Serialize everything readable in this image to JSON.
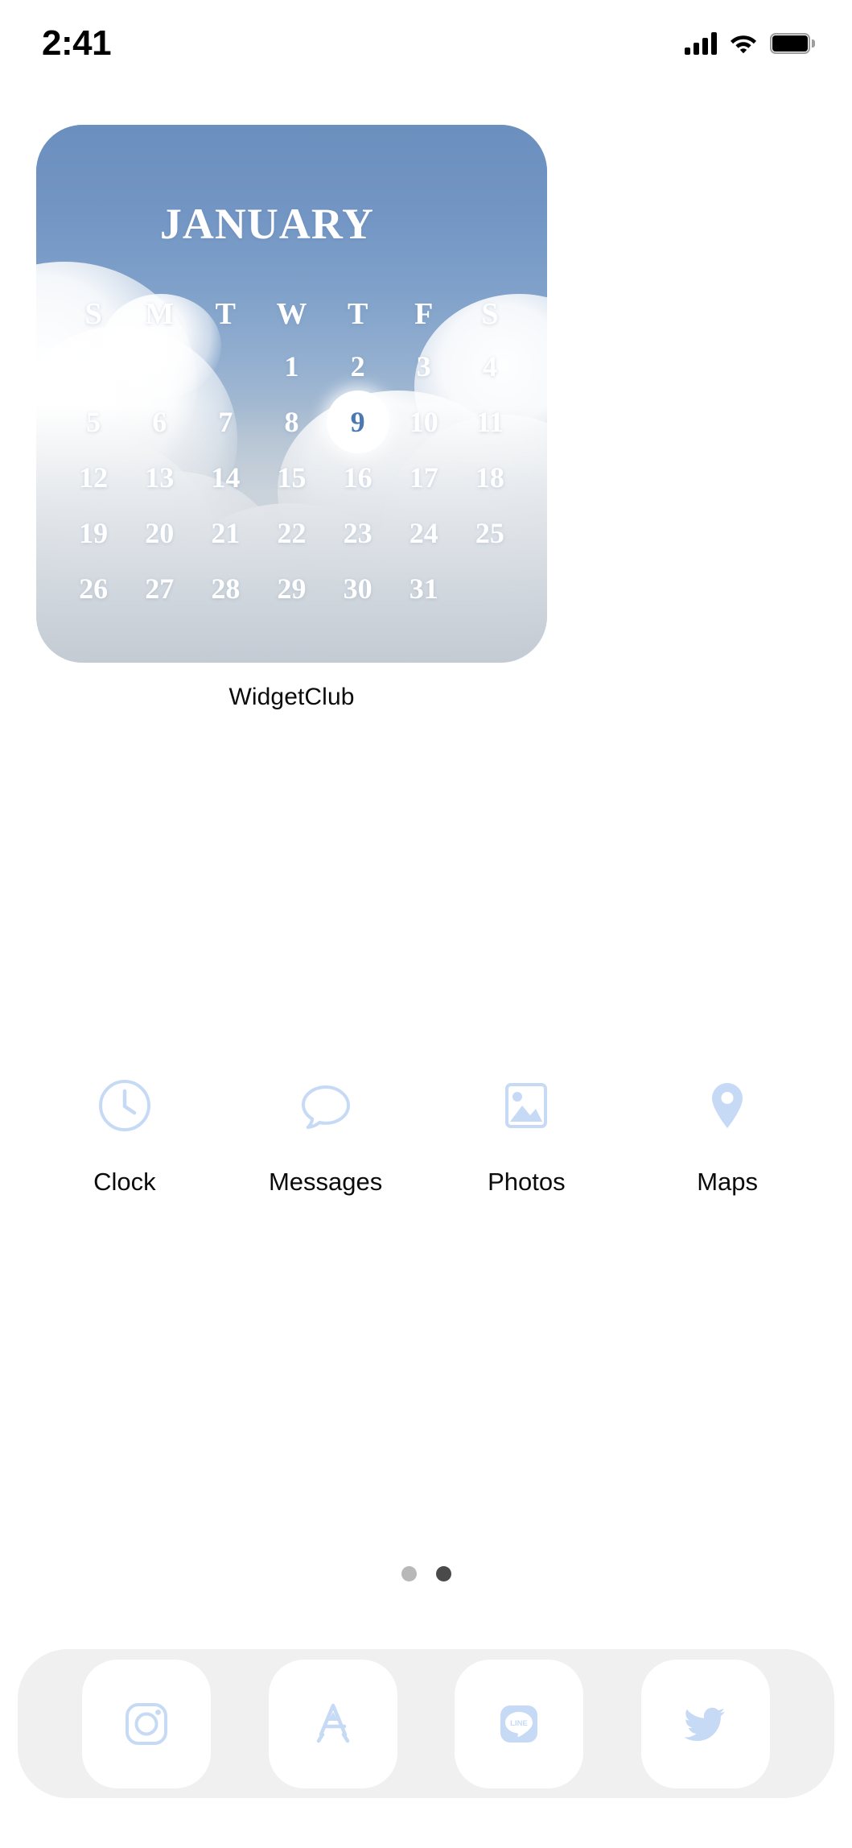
{
  "status_bar": {
    "time": "2:41",
    "signal_icon": "cellular-signal-icon",
    "wifi_icon": "wifi-icon",
    "battery_icon": "battery-full-icon"
  },
  "widget": {
    "label": "WidgetClub",
    "month": "JANUARY",
    "weekdays": [
      "S",
      "M",
      "T",
      "W",
      "T",
      "F",
      "S"
    ],
    "leading_blanks": 3,
    "days": [
      1,
      2,
      3,
      4,
      5,
      6,
      7,
      8,
      9,
      10,
      11,
      12,
      13,
      14,
      15,
      16,
      17,
      18,
      19,
      20,
      21,
      22,
      23,
      24,
      25,
      26,
      27,
      28,
      29,
      30,
      31
    ],
    "today": 9,
    "today_text_color": "#4a78b0",
    "today_circle_color": "#ffffff",
    "day_text_color": "#ffffff"
  },
  "apps": [
    {
      "label": "Clock",
      "icon": "clock-icon"
    },
    {
      "label": "Messages",
      "icon": "message-bubble-icon"
    },
    {
      "label": "Photos",
      "icon": "photo-image-icon"
    },
    {
      "label": "Maps",
      "icon": "map-pin-icon"
    }
  ],
  "app_icon_color": "#c6daf6",
  "page_dots": {
    "count": 2,
    "active_index": 1
  },
  "dock": [
    {
      "name": "Instagram",
      "icon": "instagram-icon"
    },
    {
      "name": "App Store",
      "icon": "app-store-icon"
    },
    {
      "name": "LINE",
      "icon": "line-icon",
      "glyph_text": "LINE"
    },
    {
      "name": "Twitter",
      "icon": "twitter-bird-icon"
    }
  ],
  "dock_background": "#f0f0f0",
  "dock_tile_background": "#ffffff"
}
